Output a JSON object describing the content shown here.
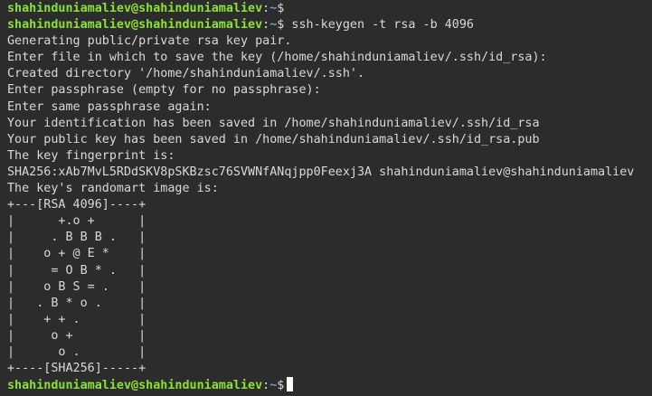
{
  "terminal": {
    "prompt": {
      "user_host": "shahinduniamaliev@shahinduniamaliev",
      "colon": ":",
      "path": "~",
      "dollar": "$"
    },
    "first_prompt_command": "",
    "command": "ssh-keygen -t rsa -b 4096",
    "output": [
      "Generating public/private rsa key pair.",
      "Enter file in which to save the key (/home/shahinduniamaliev/.ssh/id_rsa):",
      "Created directory '/home/shahinduniamaliev/.ssh'.",
      "Enter passphrase (empty for no passphrase):",
      "Enter same passphrase again:",
      "Your identification has been saved in /home/shahinduniamaliev/.ssh/id_rsa",
      "Your public key has been saved in /home/shahinduniamaliev/.ssh/id_rsa.pub",
      "The key fingerprint is:",
      "SHA256:xAb7MvL5RDdSKV8pSKBzsc76SVWNfANqjpp0Feexj3A shahinduniamaliev@shahinduniamaliev",
      "The key's randomart image is:",
      "+---[RSA 4096]----+",
      "|      +.o +      |",
      "|     . B B B .   |",
      "|    o + @ E *    |",
      "|     = O B * .   |",
      "|    o B S = .    |",
      "|   . B * o .     |",
      "|    + + .        |",
      "|     o +         |",
      "|      o .        |",
      "+----[SHA256]-----+"
    ],
    "colors": {
      "background": "#2c2c2c",
      "foreground": "#d9d9d9",
      "user_host": "#8ae234",
      "path": "#729fcf",
      "cursor": "#ffffff"
    }
  }
}
